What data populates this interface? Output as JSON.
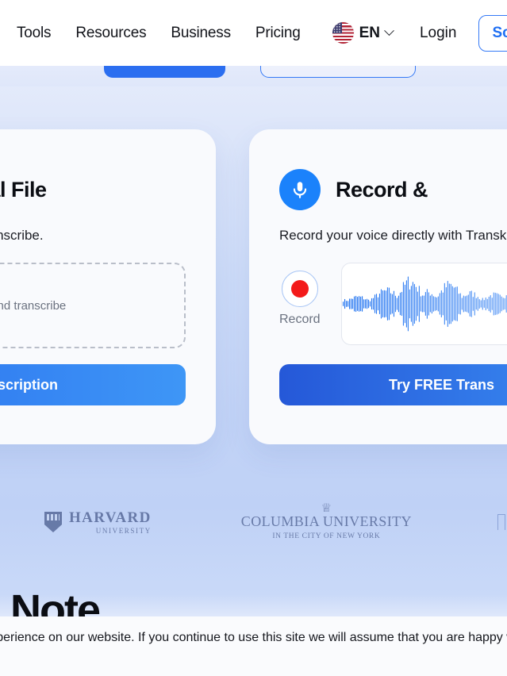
{
  "header": {
    "nav_items": [
      {
        "label": "Tools",
        "name": "nav-tools"
      },
      {
        "label": "Resources",
        "name": "nav-resources"
      },
      {
        "label": "Business",
        "name": "nav-business"
      },
      {
        "label": "Pricing",
        "name": "nav-pricing"
      }
    ],
    "language": {
      "code": "EN",
      "flag_icon": "us-flag-icon",
      "chevron_icon": "chevron-down-icon"
    },
    "login_label": "Login",
    "demo_button_label": "Sch",
    "accent_color": "#1f6ff3"
  },
  "hero_cta": {
    "primary_label": "",
    "secondary_label": ""
  },
  "cards": [
    {
      "name": "upload-local-file-card",
      "icon": "upload-icon",
      "title": "e a Local File",
      "subtitle": "your local device to transcribe.",
      "dropzone_text": "d and transcribe",
      "button_label": "nscription"
    },
    {
      "name": "record-transcribe-card",
      "icon": "microphone-icon",
      "title": "Record &",
      "subtitle": "Record your voice directly with Transk",
      "record_label": "Record",
      "button_label": "Try FREE Trans"
    }
  ],
  "logos": [
    {
      "name": "harvard-logo",
      "main": "HARVARD",
      "sub": "UNIVERSITY"
    },
    {
      "name": "columbia-logo",
      "main": "COLUMBIA UNIVERSITY",
      "sub": "IN THE CITY OF NEW YORK",
      "crown": "♕"
    },
    {
      "name": "kpmg-logo",
      "main": "KP"
    }
  ],
  "section": {
    "heading": "e on Note"
  },
  "cookie_banner": {
    "text": "we give you the best experience on our website. If you continue to use this site we will assume that you are happy with it."
  },
  "colors": {
    "brand_blue": "#1b82fb",
    "button_gradient_start": "#2558d8",
    "button_gradient_end": "#3a8df3",
    "record_dot": "#f31a1a",
    "logo_navy": "#1f3268",
    "hero_bg_top": "#e6ecfb",
    "hero_bg_bottom": "#bfd1f6"
  }
}
